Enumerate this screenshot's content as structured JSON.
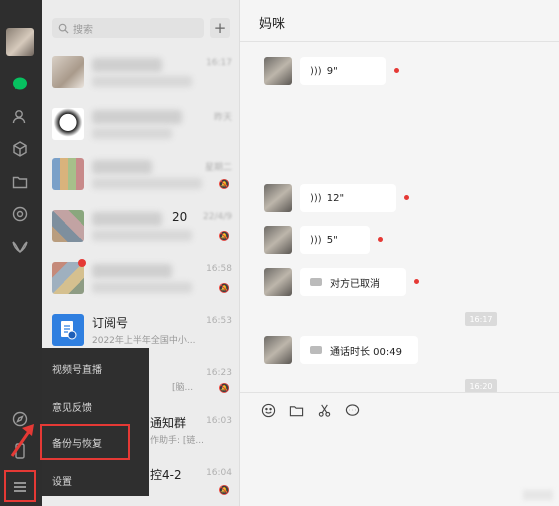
{
  "search": {
    "placeholder": "搜索",
    "plus": "+"
  },
  "chats": [
    {
      "time": "16:17"
    },
    {
      "time": "昨天"
    },
    {
      "time": "星期二"
    },
    {
      "time": "22/4/9",
      "name_fragment": "20"
    },
    {
      "time": "16:58"
    },
    {
      "title": "订阅号",
      "subtitle": "2022年上半年全国中小...",
      "time": "16:53"
    },
    {
      "time": "16:23",
      "subtitle": "[脑..."
    },
    {
      "time": "16:03",
      "title": "通知群",
      "subtitle": "作助手: [链..."
    },
    {
      "time": "16:04",
      "title": "控4-2"
    }
  ],
  "menu": {
    "items": [
      "视频号直播",
      "意见反馈",
      "备份与恢复",
      "设置"
    ]
  },
  "chat": {
    "title": "妈咪",
    "messages": [
      {
        "kind": "voice",
        "text": "9\""
      },
      {
        "kind": "voice",
        "text": "12\""
      },
      {
        "kind": "voice",
        "text": "5\""
      },
      {
        "kind": "video",
        "text": "对方已取消"
      },
      {
        "kind": "timestamp",
        "text": "16:17"
      },
      {
        "kind": "video",
        "text": "通话时长 00:49"
      },
      {
        "kind": "timestamp",
        "text": "16:20"
      }
    ]
  },
  "colors": {
    "rail": "#2e2e2e",
    "accent": "#07c160",
    "highlight": "#e53935"
  }
}
